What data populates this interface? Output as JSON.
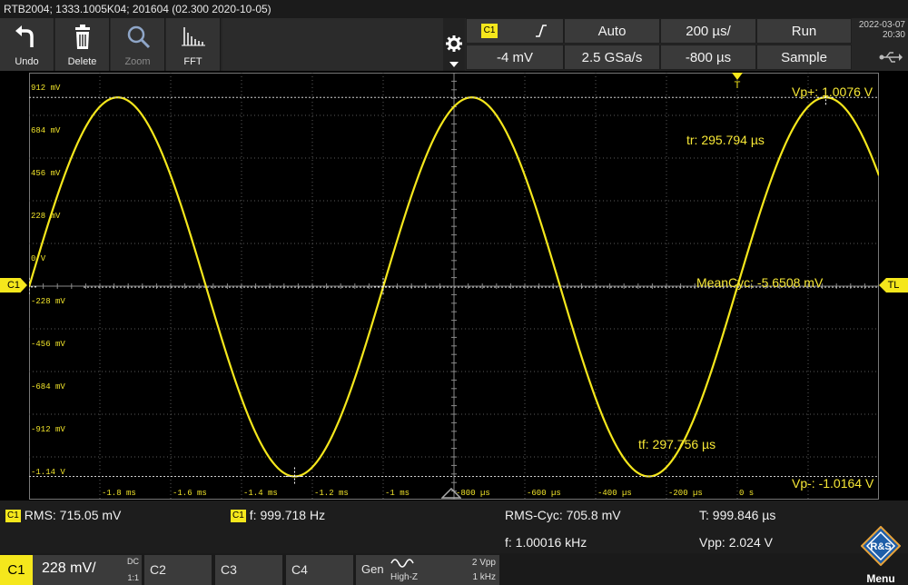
{
  "title": "RTB2004; 1333.1005K04; 201604 (02.300 2020-10-05)",
  "toolbar": {
    "undo": "Undo",
    "delete": "Delete",
    "zoom": "Zoom",
    "fft": "FFT"
  },
  "trigger": {
    "source": "C1",
    "level": "-4 mV",
    "mode": "Auto",
    "sample_rate": "2.5 GSa/s",
    "timebase": "200 µs/",
    "position": "-800 µs",
    "run_state": "Run",
    "acq_mode": "Sample"
  },
  "datetime": {
    "date": "2022-03-07",
    "time": "20:30"
  },
  "markers": {
    "channel": "C1",
    "trigger_level": "TL",
    "trigger_pos": "T"
  },
  "y_labels": [
    "912 mV",
    "684 mV",
    "456 mV",
    "228 mV",
    "0 V",
    "-228 mV",
    "-456 mV",
    "-684 mV",
    "-912 mV",
    "-1.14 V"
  ],
  "x_labels": [
    "-1.8 ms",
    "-1.6 ms",
    "-1.4 ms",
    "-1.2 ms",
    "-1 ms",
    "-800 µs",
    "-600 µs",
    "-400 µs",
    "-200 µs",
    "0 s"
  ],
  "annotations": {
    "vpp_pos": "Vp+: 1.0076 V",
    "rise": "tr: 295.794 µs",
    "mean": "MeanCyc: -5.6508 mV",
    "fall": "tf: 297.756 µs",
    "vpp_neg": "Vp-: -1.0164 V"
  },
  "measurements": {
    "rms_label": "RMS: 715.05 mV",
    "freq_label": "f: 999.718 Hz",
    "rms_cyc": "RMS-Cyc: 705.8 mV",
    "period": "T: 999.846 µs",
    "freq2": "f: 1.00016 kHz",
    "vpp": "Vpp: 2.024 V",
    "badge": "C1"
  },
  "channels": {
    "c1": "C1",
    "c1_scale": "228 mV/",
    "c1_coupling": "DC",
    "c1_ratio": "1:1",
    "c2": "C2",
    "c3": "C3",
    "c4": "C4",
    "gen": "Gen",
    "gen_imp": "High-Z",
    "gen_amp": "2 Vpp",
    "gen_freq": "1 kHz",
    "menu": "Menu"
  },
  "colors": {
    "trace": "#f5e71c",
    "grid": "#5a5a5a"
  },
  "waveform": {
    "amplitude_v": 1.012,
    "offset_v": -0.004,
    "frequency_hz": 1000,
    "phase_deg": 0
  }
}
